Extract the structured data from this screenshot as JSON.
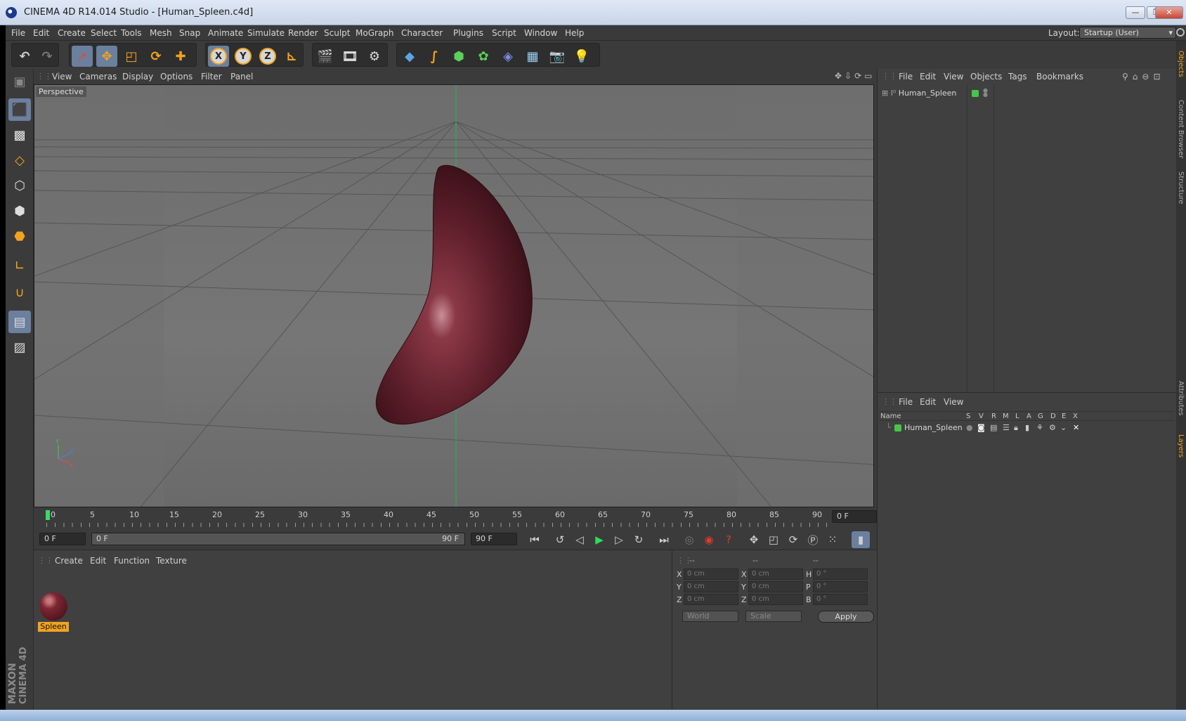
{
  "window": {
    "title": "CINEMA 4D R14.014 Studio - [Human_Spleen.c4d]",
    "controls": [
      "—",
      "❐",
      "✕"
    ]
  },
  "menubar": {
    "items": [
      "File",
      "Edit",
      "Create",
      "Select",
      "Tools",
      "Mesh",
      "Snap",
      "Animate",
      "Simulate",
      "Render",
      "Sculpt",
      "MoGraph",
      "Character",
      "Plugins",
      "Script",
      "Window",
      "Help"
    ],
    "layout_label": "Layout:",
    "layout_value": "Startup (User)"
  },
  "toolbar": {
    "axis_x": "X",
    "axis_y": "Y",
    "axis_z": "Z"
  },
  "viewport": {
    "menu": [
      "View",
      "Cameras",
      "Display",
      "Options",
      "Filter",
      "Panel"
    ],
    "label": "Perspective",
    "axis_labels": {
      "y": "Y",
      "z": "Z",
      "x": "X"
    }
  },
  "timeline": {
    "ticks": [
      "0",
      "5",
      "10",
      "15",
      "20",
      "25",
      "30",
      "35",
      "40",
      "45",
      "50",
      "55",
      "60",
      "65",
      "70",
      "75",
      "80",
      "85",
      "90"
    ],
    "current_frame": "0 F",
    "start_frame": "0 F",
    "range_start": "0 F",
    "range_end": "90 F",
    "end_frame": "90 F"
  },
  "material_panel": {
    "menu": [
      "Create",
      "Edit",
      "Function",
      "Texture"
    ],
    "material_name": "Spleen"
  },
  "coordinates": {
    "headers": [
      "--",
      "--",
      "--"
    ],
    "rows": [
      {
        "a": "X",
        "av": "0 cm",
        "b": "X",
        "bv": "0 cm",
        "c": "H",
        "cv": "0 °"
      },
      {
        "a": "Y",
        "av": "0 cm",
        "b": "Y",
        "bv": "0 cm",
        "c": "P",
        "cv": "0 °"
      },
      {
        "a": "Z",
        "av": "0 cm",
        "b": "Z",
        "bv": "0 cm",
        "c": "B",
        "cv": "0 °"
      }
    ],
    "mode": "World",
    "scale": "Scale",
    "apply": "Apply"
  },
  "object_manager": {
    "menu": [
      "File",
      "Edit",
      "View",
      "Objects",
      "Tags",
      "Bookmarks"
    ],
    "object_name": "Human_Spleen"
  },
  "layer_manager": {
    "menu": [
      "File",
      "Edit",
      "View"
    ],
    "columns": [
      "Name",
      "S",
      "V",
      "R",
      "M",
      "L",
      "A",
      "G",
      "D",
      "E",
      "X"
    ],
    "layer_name": "Human_Spleen"
  },
  "side_tabs": [
    "Objects",
    "Content Browser",
    "Structure",
    "Attributes",
    "Layers"
  ],
  "brand": {
    "line1": "MAXON",
    "line2": "CINEMA 4D"
  },
  "colors": {
    "accent": "#f2a320",
    "active_button": "#6b7f9f",
    "layer_green": "#45c64a",
    "play_green": "#2ede5a"
  }
}
